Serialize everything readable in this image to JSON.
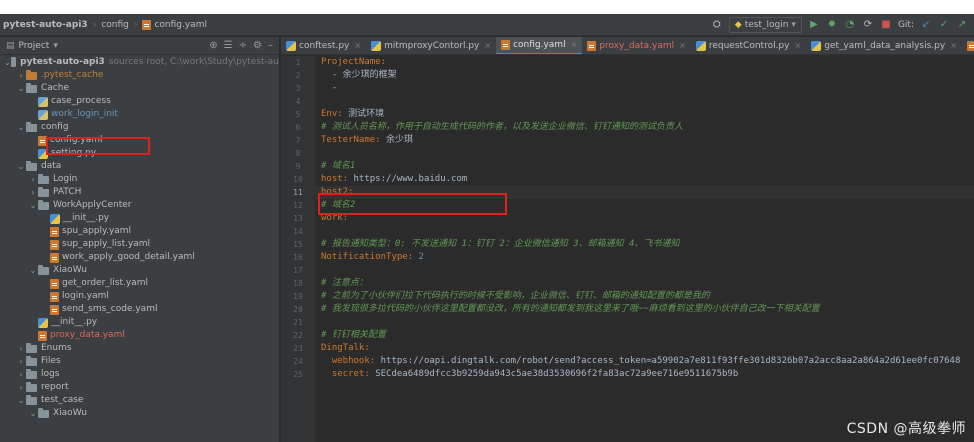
{
  "breadcrumb": {
    "project": "pytest-auto-api3",
    "folder": "config",
    "file": "config.yaml"
  },
  "toolbar": {
    "run_config": "test_login",
    "git_label": "Git:"
  },
  "sidebar": {
    "title": "Project",
    "items": [
      {
        "label": "pytest-auto-api3",
        "hint": "sources root, C:\\work\\Study\\pytest-au",
        "kind": "folder-root"
      },
      {
        "label": ".pytest_cache",
        "kind": "folder-excluded"
      },
      {
        "label": "Cache",
        "kind": "folder"
      },
      {
        "label": "case_process",
        "kind": "file"
      },
      {
        "label": "work_login_init",
        "kind": "file-link"
      },
      {
        "label": "config",
        "kind": "folder"
      },
      {
        "label": "config.yaml",
        "kind": "yaml"
      },
      {
        "label": "setting.py",
        "kind": "py"
      },
      {
        "label": "data",
        "kind": "folder"
      },
      {
        "label": "Login",
        "kind": "folder"
      },
      {
        "label": "PATCH",
        "kind": "folder"
      },
      {
        "label": "WorkApplyCenter",
        "kind": "folder"
      },
      {
        "label": "__init__.py",
        "kind": "py"
      },
      {
        "label": "spu_apply.yaml",
        "kind": "yaml"
      },
      {
        "label": "sup_apply_list.yaml",
        "kind": "yaml"
      },
      {
        "label": "work_apply_good_detail.yaml",
        "kind": "yaml"
      },
      {
        "label": "XiaoWu",
        "kind": "folder"
      },
      {
        "label": "get_order_list.yaml",
        "kind": "yaml"
      },
      {
        "label": "login.yaml",
        "kind": "yaml"
      },
      {
        "label": "send_sms_code.yaml",
        "kind": "yaml"
      },
      {
        "label": "__init__.py",
        "kind": "py"
      },
      {
        "label": "proxy_data.yaml",
        "kind": "yaml-red"
      },
      {
        "label": "Enums",
        "kind": "folder"
      },
      {
        "label": "Files",
        "kind": "folder"
      },
      {
        "label": "logs",
        "kind": "folder"
      },
      {
        "label": "report",
        "kind": "folder"
      },
      {
        "label": "test_case",
        "kind": "folder"
      },
      {
        "label": "XiaoWu",
        "kind": "folder"
      }
    ]
  },
  "tabs": [
    {
      "label": "conftest.py",
      "kind": "py"
    },
    {
      "label": "mitmproxyContorl.py",
      "kind": "py"
    },
    {
      "label": "config.yaml",
      "kind": "yaml",
      "active": true
    },
    {
      "label": "proxy_data.yaml",
      "kind": "yaml-red"
    },
    {
      "label": "requestControl.py",
      "kind": "py"
    },
    {
      "label": "get_yaml_data_analysis.py",
      "kind": "py"
    },
    {
      "label": "send_sms_c",
      "kind": "yaml"
    }
  ],
  "editor": {
    "current_line": 11,
    "lines": [
      [
        {
          "t": "k",
          "s": "ProjectName:"
        }
      ],
      [
        {
          "t": "v",
          "s": "  - 余少琪的框架"
        }
      ],
      [
        {
          "t": "v",
          "s": "  -"
        }
      ],
      [
        {
          "t": "v",
          "s": ""
        }
      ],
      [
        {
          "t": "k",
          "s": "Env:"
        },
        {
          "t": "v",
          "s": " 测试环境"
        }
      ],
      [
        {
          "t": "c",
          "s": "# 测试人员名称，作用于自动生成代码的作者，以及发送企业微信、钉钉通知的测试负责人"
        }
      ],
      [
        {
          "t": "k",
          "s": "TesterName:"
        },
        {
          "t": "v",
          "s": " 余少琪"
        }
      ],
      [
        {
          "t": "v",
          "s": ""
        }
      ],
      [
        {
          "t": "c",
          "s": "# 域名1"
        }
      ],
      [
        {
          "t": "k",
          "s": "host:"
        },
        {
          "t": "v",
          "s": " https://www.baidu.com"
        }
      ],
      [
        {
          "t": "k",
          "s": "host2:"
        }
      ],
      [
        {
          "t": "c",
          "s": "# 域名2"
        }
      ],
      [
        {
          "t": "k",
          "s": "work:"
        }
      ],
      [
        {
          "t": "v",
          "s": ""
        }
      ],
      [
        {
          "t": "c",
          "s": "# 报告通知类型：0: 不发送通知 1：钉钉 2：企业微信通知 3、邮箱通知 4、飞书通知"
        }
      ],
      [
        {
          "t": "k",
          "s": "NotificationType:"
        },
        {
          "t": "n",
          "s": " 2"
        }
      ],
      [
        {
          "t": "v",
          "s": ""
        }
      ],
      [
        {
          "t": "c",
          "s": "# 注意点："
        }
      ],
      [
        {
          "t": "c",
          "s": "# 之前为了小伙伴们拉下代码执行的时候不受影响，企业微信、钉钉、邮箱的通知配置的都是我的"
        }
      ],
      [
        {
          "t": "c",
          "s": "# 我发现很多拉代码的小伙伴这里配置都没改，所有的通知都发到我这里来了哦~~麻烦看到这里的小伙伴自己改一下相关配置"
        }
      ],
      [
        {
          "t": "v",
          "s": ""
        }
      ],
      [
        {
          "t": "c",
          "s": "# 钉钉相关配置"
        }
      ],
      [
        {
          "t": "k",
          "s": "DingTalk:"
        }
      ],
      [
        {
          "t": "k",
          "s": "  webhook:"
        },
        {
          "t": "v",
          "s": " https://oapi.dingtalk.com/robot/send?access_token=a59902a7e811f93ffe301d8326b07a2acc8aa2a864a2d61ee0fc07648"
        }
      ],
      [
        {
          "t": "k",
          "s": "  secret:"
        },
        {
          "t": "v",
          "s": " SECdea6489dfcc3b9259da943c5ae38d3530696f2fa83ac72a9ee716e9511675b9b"
        }
      ]
    ]
  },
  "watermark": "CSDN @高级拳师"
}
